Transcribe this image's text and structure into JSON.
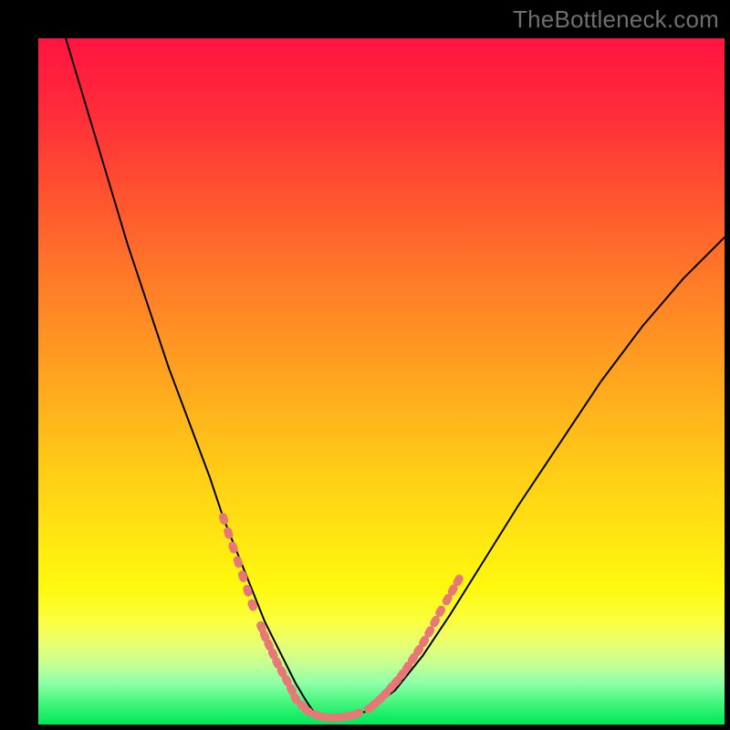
{
  "watermark": "TheBottleneck.com",
  "chart_data": {
    "type": "line",
    "title": "",
    "xlabel": "",
    "ylabel": "",
    "xlim": [
      0,
      100
    ],
    "ylim": [
      0,
      100
    ],
    "series": [
      {
        "name": "curve",
        "x": [
          4,
          7,
          10,
          13,
          16,
          19,
          22,
          25,
          27,
          29,
          31,
          33,
          34.5,
          36,
          37.5,
          39,
          40,
          42,
          45,
          48,
          52,
          56,
          60,
          65,
          70,
          76,
          82,
          88,
          94,
          100
        ],
        "y": [
          100,
          90,
          80,
          70,
          61,
          52,
          44,
          36,
          30,
          25,
          20,
          15,
          12,
          9,
          6,
          3.5,
          2,
          1,
          1,
          2,
          5,
          10,
          16,
          24,
          32,
          41,
          50,
          58,
          65,
          71
        ]
      }
    ],
    "markers": {
      "name": "dotted-segments",
      "color": "#e87878",
      "x": [
        27.0,
        27.7,
        28.4,
        29.1,
        29.8,
        30.5,
        31.2,
        32.5,
        33.0,
        33.6,
        34.2,
        34.8,
        35.5,
        36.2,
        36.9,
        37.5,
        38.5,
        39.2,
        40.5,
        41.5,
        42.5,
        43.5,
        44.5,
        45.5,
        46.5,
        48.3,
        49.0,
        49.8,
        50.6,
        51.4,
        52.2,
        53.0,
        53.8,
        54.6,
        55.4,
        56.2,
        57.0,
        57.8,
        58.6,
        59.6,
        60.4,
        61.2
      ],
      "y": [
        30.0,
        27.9,
        25.8,
        23.7,
        21.6,
        19.5,
        17.4,
        14.2,
        12.9,
        11.6,
        10.3,
        9.0,
        7.7,
        6.4,
        5.1,
        3.8,
        2.7,
        2.0,
        1.4,
        1.1,
        1.0,
        1.0,
        1.1,
        1.3,
        1.6,
        2.4,
        3.0,
        3.7,
        4.5,
        5.4,
        6.3,
        7.3,
        8.4,
        9.6,
        10.8,
        12.1,
        13.5,
        15.0,
        16.5,
        18.2,
        19.6,
        21.0
      ]
    },
    "background_gradient": {
      "top": "#ff1440",
      "mid": "#ffd400",
      "bottom": "#00e85a"
    }
  }
}
